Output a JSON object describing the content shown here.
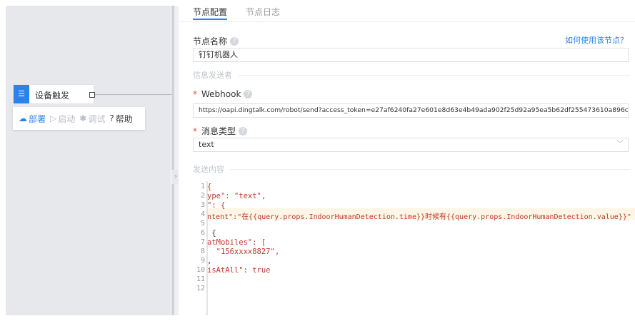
{
  "canvas": {
    "node": {
      "label": "设备触发"
    },
    "toolbar": {
      "deploy": "部署",
      "start": "启动",
      "debug": "调试",
      "help": "帮助"
    }
  },
  "tabs": [
    "节点配置",
    "节点日志"
  ],
  "form": {
    "node_name_label": "节点名称",
    "how_to_link": "如何使用该节点？",
    "node_name_value": "钉钉机器人",
    "section_sender": "信息发送者",
    "webhook_label": "Webhook",
    "webhook_value": "https://oapi.dingtalk.com/robot/send?access_token=e27af6240fa27e601e8d63e4b49ada902f25d92a95ea5b62df255473610a896c",
    "msg_type_label": "消息类型",
    "msg_type_value": "text",
    "section_content": "发送内容"
  },
  "editor": {
    "line_numbers": [
      "1",
      "2",
      "3",
      "4",
      "5",
      "6",
      "7",
      "8",
      "9",
      "10",
      "11",
      "12"
    ],
    "lines": [
      "{",
      "ype\": \"text\",",
      "\": {",
      "ntent\":\"在{{query.props.IndoorHumanDetection.time}}时候有{{query.props.IndoorHumanDetection.value}}\"",
      "",
      " {",
      "atMobiles\": [",
      "  \"156xxxx8827\",",
      ",",
      "isAtAll\": true",
      "",
      ""
    ]
  },
  "colors": {
    "accent": "#2b82e8",
    "required": "#e8503a",
    "string": "#c0392b"
  }
}
